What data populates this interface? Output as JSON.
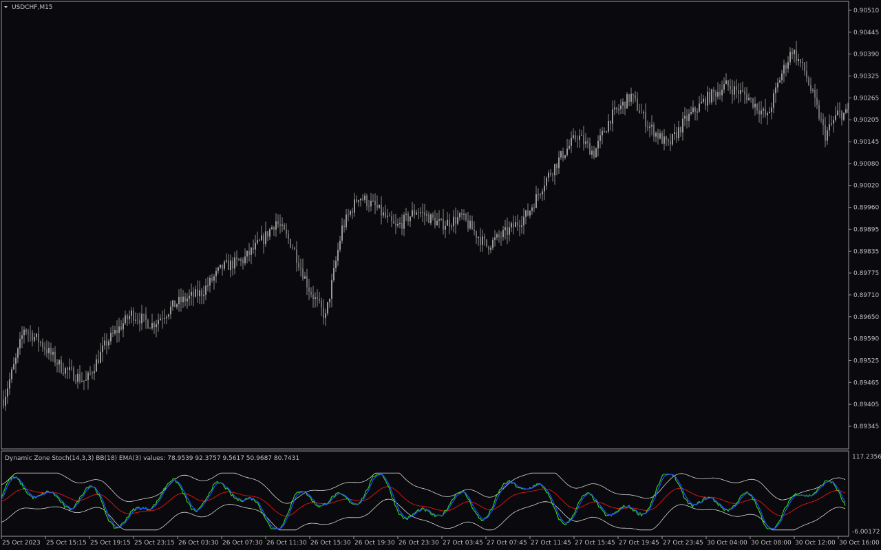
{
  "window": {
    "symbol_title": "USDCHF,M15"
  },
  "indicator": {
    "label": "Dynamic Zone Stoch(14,3,3) BB(18) EMA(3) values:  78.9539 92.3757 9.5617 50.9687 80.7431",
    "scale_top": "117.2356",
    "scale_bottom": "-6.00172"
  },
  "colors": {
    "background": "#0a0a0e",
    "frame": "#9a9a9a",
    "candle": "#8a8a8a",
    "stoch_green": "#33cc22",
    "ema_blue": "#1f4fff",
    "mid_red": "#dd1111",
    "bands_white": "#d8d8d8"
  },
  "price_axis": {
    "labels": [
      "0.90510",
      "0.90445",
      "0.90390",
      "0.90325",
      "0.90265",
      "0.90205",
      "0.90145",
      "0.90080",
      "0.90020",
      "0.89960",
      "0.89895",
      "0.89835",
      "0.89775",
      "0.89710",
      "0.89650",
      "0.89590",
      "0.89525",
      "0.89465",
      "0.89405",
      "0.89345"
    ]
  },
  "time_axis": {
    "labels": [
      "25 Oct 2023",
      "25 Oct 15:15",
      "25 Oct 19:15",
      "25 Oct 23:15",
      "26 Oct 03:30",
      "26 Oct 07:30",
      "26 Oct 11:30",
      "26 Oct 15:30",
      "26 Oct 19:30",
      "26 Oct 23:30",
      "27 Oct 03:45",
      "27 Oct 07:45",
      "27 Oct 11:45",
      "27 Oct 15:45",
      "27 Oct 19:45",
      "27 Oct 23:45",
      "30 Oct 04:00",
      "30 Oct 08:00",
      "30 Oct 12:00",
      "30 Oct 16:00"
    ]
  },
  "chart_data": {
    "type": "candlestick",
    "symbol": "USDCHF",
    "timeframe": "M15",
    "ylim": [
      0.89345,
      0.9051
    ],
    "close_path": [
      [
        0,
        0.8942
      ],
      [
        6,
        0.8953
      ],
      [
        10,
        0.8962
      ],
      [
        18,
        0.8958
      ],
      [
        28,
        0.8951
      ],
      [
        40,
        0.8947
      ],
      [
        50,
        0.8958
      ],
      [
        62,
        0.8966
      ],
      [
        72,
        0.8963
      ],
      [
        84,
        0.8969
      ],
      [
        96,
        0.8972
      ],
      [
        106,
        0.8979
      ],
      [
        116,
        0.8981
      ],
      [
        126,
        0.8987
      ],
      [
        132,
        0.8992
      ],
      [
        140,
        0.8985
      ],
      [
        148,
        0.8973
      ],
      [
        156,
        0.8965
      ],
      [
        164,
        0.899
      ],
      [
        172,
        0.8999
      ],
      [
        180,
        0.8996
      ],
      [
        190,
        0.899
      ],
      [
        200,
        0.8995
      ],
      [
        212,
        0.8991
      ],
      [
        222,
        0.8993
      ],
      [
        234,
        0.8985
      ],
      [
        244,
        0.8989
      ],
      [
        254,
        0.8994
      ],
      [
        262,
        0.9003
      ],
      [
        270,
        0.901
      ],
      [
        278,
        0.9016
      ],
      [
        286,
        0.9011
      ],
      [
        294,
        0.9021
      ],
      [
        304,
        0.9027
      ],
      [
        312,
        0.9019
      ],
      [
        322,
        0.9013
      ],
      [
        330,
        0.902
      ],
      [
        340,
        0.9026
      ],
      [
        350,
        0.903
      ],
      [
        360,
        0.9027
      ],
      [
        370,
        0.9021
      ],
      [
        376,
        0.9032
      ],
      [
        382,
        0.904
      ],
      [
        388,
        0.9034
      ],
      [
        392,
        0.9027
      ],
      [
        398,
        0.9016
      ],
      [
        404,
        0.9022
      ]
    ],
    "stochastic": {
      "ylim": [
        -6.00172,
        117.2356
      ],
      "last_values": [
        78.9539,
        92.3757,
        9.5617,
        50.9687,
        80.7431
      ]
    }
  }
}
